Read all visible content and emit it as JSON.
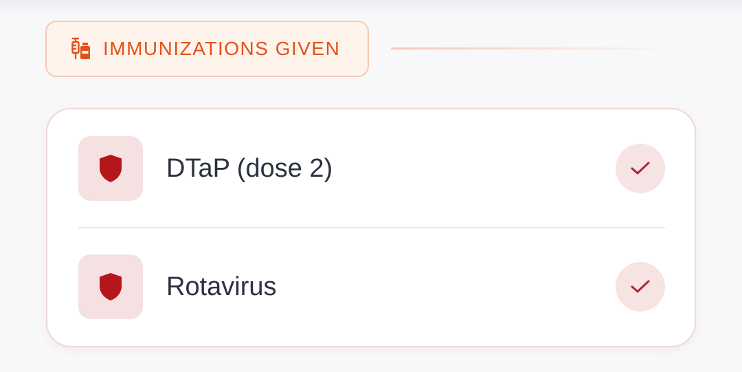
{
  "section": {
    "title": "IMMUNIZATIONS GIVEN",
    "icon": "syringe-vial-icon"
  },
  "immunizations": [
    {
      "name": "DTaP (dose 2)",
      "icon": "shield-icon",
      "status": "check-icon"
    },
    {
      "name": "Rotavirus",
      "icon": "shield-icon",
      "status": "check-icon"
    }
  ],
  "colors": {
    "accent": "#e0521a",
    "shield": "#b5161c",
    "check": "#b5232b",
    "badge_bg": "#f5e1e2",
    "text": "#2b3140"
  }
}
